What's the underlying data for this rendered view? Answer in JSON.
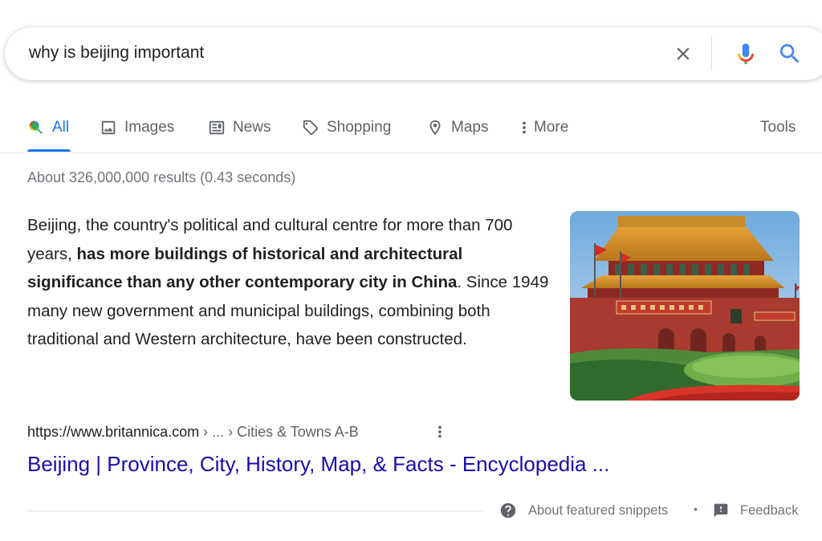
{
  "search": {
    "query": "why is beijing important"
  },
  "tabs": [
    {
      "label": "All",
      "icon": "search-icon",
      "active": true
    },
    {
      "label": "Images",
      "icon": "image-icon"
    },
    {
      "label": "News",
      "icon": "news-icon"
    },
    {
      "label": "Shopping",
      "icon": "tag-icon"
    },
    {
      "label": "Maps",
      "icon": "map-pin-icon"
    },
    {
      "label": "More",
      "icon": "more-vert-icon"
    }
  ],
  "tools_label": "Tools",
  "result_stats": "About 326,000,000 results (0.43 seconds)",
  "featured_snippet": {
    "text_before": "Beijing, the country's political and cultural centre for more than 700 years, ",
    "text_bold": "has more buildings of historical and architectural significance than any other contemporary city in China",
    "text_after": ". Since 1949 many new government and municipal buildings, combining both traditional and Western architecture, have been constructed.",
    "image_subject": "Tiananmen gate with red walls, flags and green hedges"
  },
  "result": {
    "url": "https://www.britannica.com",
    "breadcrumb": " › ... › Cities & Towns A-B",
    "title": "Beijing | Province, City, History, Map, & Facts - Encyclopedia ..."
  },
  "footer": {
    "about_label": "About featured snippets",
    "separator": "•",
    "feedback_label": "Feedback"
  },
  "colors": {
    "link": "#1a0dab",
    "accent": "#1a73e8",
    "muted": "#70757a",
    "text": "#202124"
  }
}
